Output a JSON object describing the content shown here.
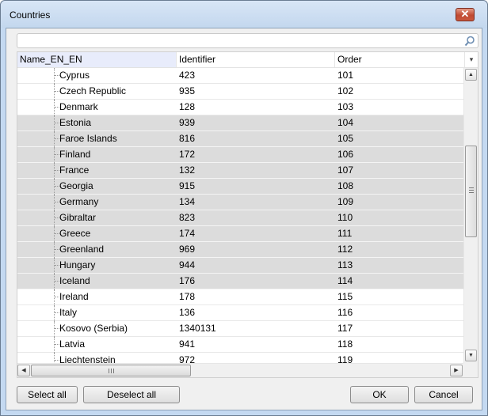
{
  "window": {
    "title": "Countries",
    "close_glyph": "✕"
  },
  "search": {
    "value": "",
    "placeholder": "",
    "icon": "search-icon"
  },
  "grid": {
    "columns": [
      "Name_EN_EN",
      "Identifier",
      "Order"
    ],
    "column_menu_glyph": "▾",
    "rows": [
      {
        "name": "Cyprus",
        "identifier": "423",
        "order": "101",
        "selected": false
      },
      {
        "name": "Czech Republic",
        "identifier": "935",
        "order": "102",
        "selected": false
      },
      {
        "name": "Denmark",
        "identifier": "128",
        "order": "103",
        "selected": false
      },
      {
        "name": "Estonia",
        "identifier": "939",
        "order": "104",
        "selected": true
      },
      {
        "name": "Faroe Islands",
        "identifier": "816",
        "order": "105",
        "selected": true
      },
      {
        "name": "Finland",
        "identifier": "172",
        "order": "106",
        "selected": true
      },
      {
        "name": "France",
        "identifier": "132",
        "order": "107",
        "selected": true
      },
      {
        "name": "Georgia",
        "identifier": "915",
        "order": "108",
        "selected": true
      },
      {
        "name": "Germany",
        "identifier": "134",
        "order": "109",
        "selected": true
      },
      {
        "name": "Gibraltar",
        "identifier": "823",
        "order": "110",
        "selected": true
      },
      {
        "name": "Greece",
        "identifier": "174",
        "order": "111",
        "selected": true
      },
      {
        "name": "Greenland",
        "identifier": "969",
        "order": "112",
        "selected": true
      },
      {
        "name": "Hungary",
        "identifier": "944",
        "order": "113",
        "selected": true
      },
      {
        "name": "Iceland",
        "identifier": "176",
        "order": "114",
        "selected": true
      },
      {
        "name": "Ireland",
        "identifier": "178",
        "order": "115",
        "selected": false
      },
      {
        "name": "Italy",
        "identifier": "136",
        "order": "116",
        "selected": false
      },
      {
        "name": "Kosovo (Serbia)",
        "identifier": "1340131",
        "order": "117",
        "selected": false
      },
      {
        "name": "Latvia",
        "identifier": "941",
        "order": "118",
        "selected": false
      },
      {
        "name": "Liechtenstein",
        "identifier": "972",
        "order": "119",
        "selected": false
      }
    ]
  },
  "buttons": {
    "select_all": "Select all",
    "deselect_all": "Deselect all",
    "ok": "OK",
    "cancel": "Cancel"
  },
  "colors": {
    "title_bar": "#c4d9f1",
    "selected_row": "#dcdcdc",
    "header_active": "#e8ecfb",
    "close_button": "#c04a31"
  }
}
